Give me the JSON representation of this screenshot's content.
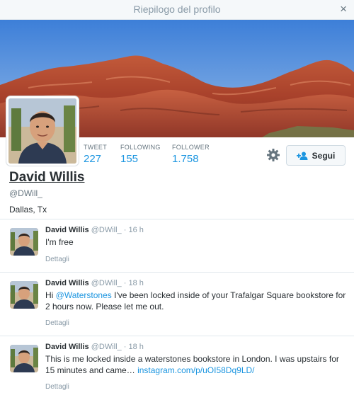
{
  "window": {
    "title": "Riepilogo del profilo",
    "close_glyph": "×"
  },
  "profile": {
    "name": "David Willis",
    "handle": "@DWill_",
    "location": "Dallas, Tx",
    "stats": [
      {
        "label": "TWEET",
        "value": "227"
      },
      {
        "label": "FOLLOWING",
        "value": "155"
      },
      {
        "label": "FOLLOWER",
        "value": "1.758"
      }
    ],
    "follow_label": "Segui",
    "follow_icon": "add-person-icon",
    "settings_icon": "gear-icon"
  },
  "tweets": [
    {
      "name": "David Willis",
      "handle": "@DWill_",
      "sep": "·",
      "time": "16 h",
      "text_before": "I'm free",
      "link": "",
      "text_after": "",
      "details": "Dettagli"
    },
    {
      "name": "David Willis",
      "handle": "@DWill_",
      "sep": "·",
      "time": "18 h",
      "text_before": "Hi ",
      "link": "@Waterstones",
      "text_after": " I've been locked inside of your Trafalgar Square bookstore for 2 hours now.  Please let me out.",
      "details": "Dettagli"
    },
    {
      "name": "David Willis",
      "handle": "@DWill_",
      "sep": "·",
      "time": "18 h",
      "text_before": "This is me locked inside a waterstones bookstore in London.  I was upstairs for 15 minutes and came… ",
      "link": "instagram.com/p/uOI58Dq9LD/",
      "text_after": "",
      "details": "Dettagli"
    }
  ],
  "colors": {
    "accent": "#1b95e0",
    "sky": "#4a86d6",
    "rock": "#b0452c"
  }
}
